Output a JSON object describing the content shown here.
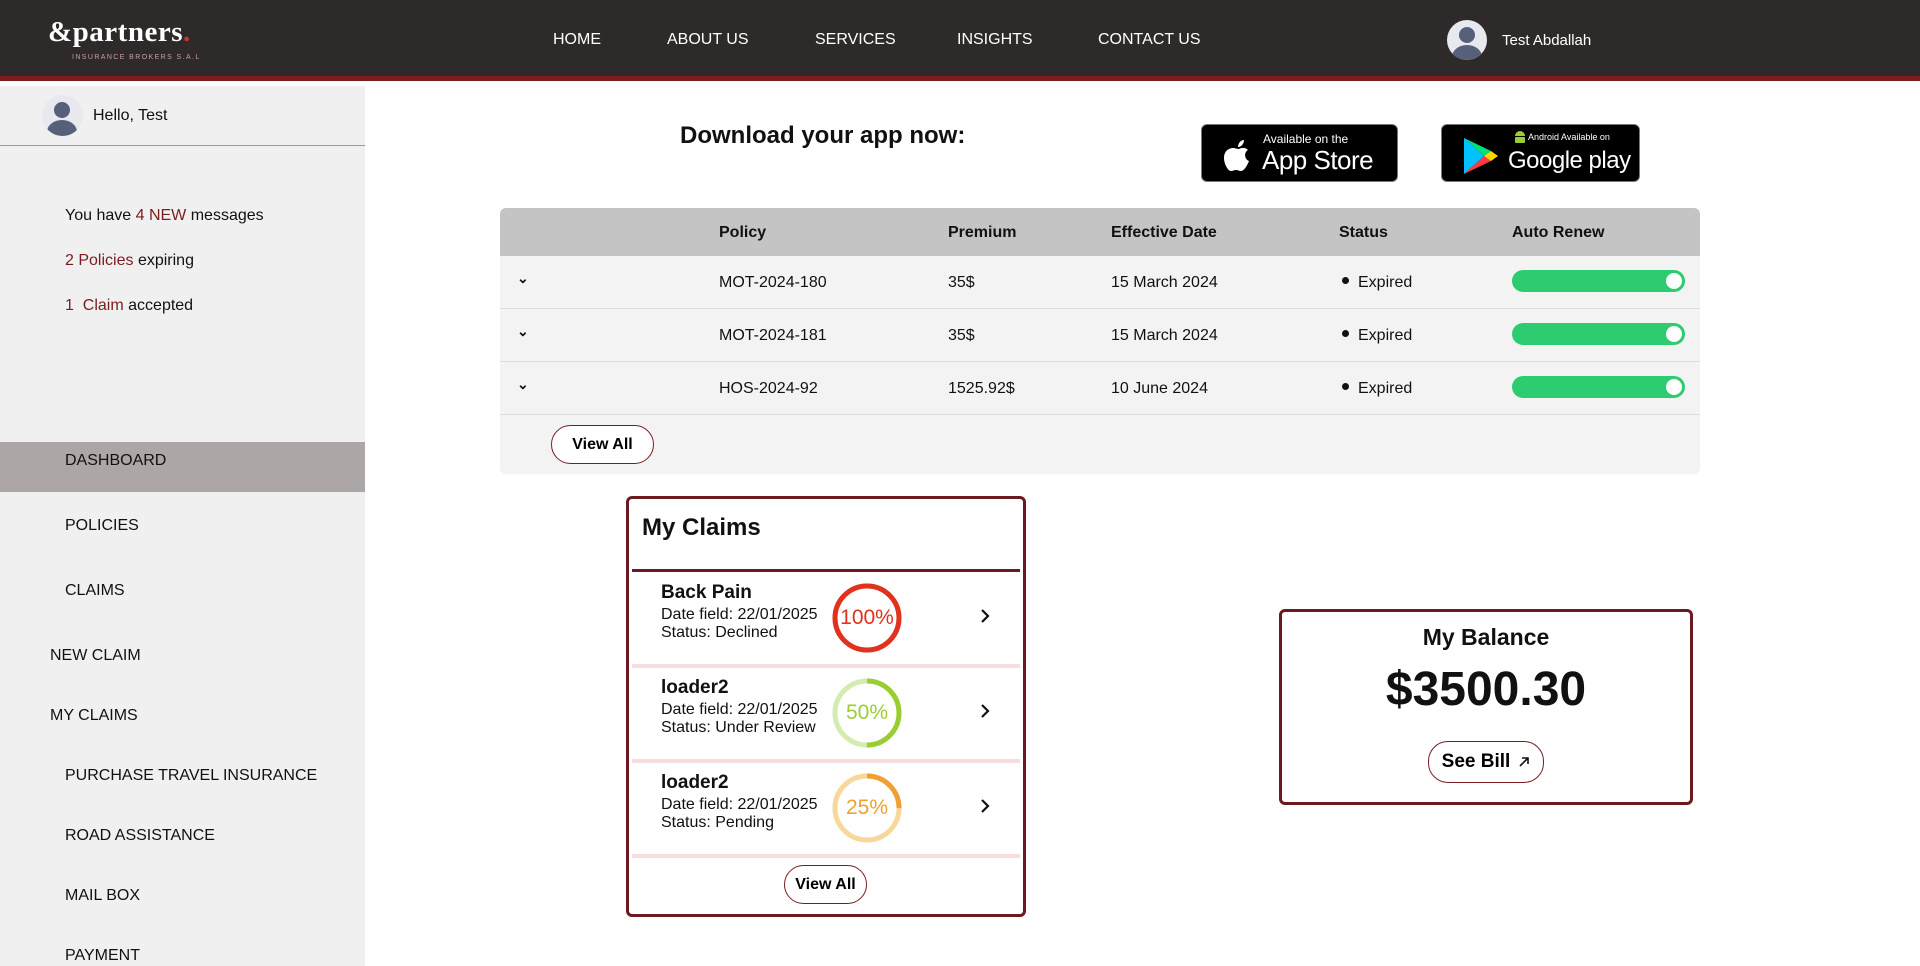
{
  "header": {
    "logo": {
      "symbol": "&",
      "word": "partners",
      "tagline": "INSURANCE BROKERS S.A.L"
    },
    "nav": [
      "HOME",
      "ABOUT US",
      "SERVICES",
      "INSIGHTS",
      "CONTACT US"
    ],
    "user_name": "Test Abdallah"
  },
  "sidebar": {
    "greeting": "Hello, Test",
    "notifications": {
      "messages_prefix": "You have",
      "messages_count": "4 NEW",
      "messages_suffix": "messages",
      "policies_count": "2 Policies",
      "policies_suffix": "expiring",
      "claims_count": "1  Claim",
      "claims_suffix": "accepted"
    },
    "menu": [
      "DASHBOARD",
      "POLICIES",
      "CLAIMS",
      "NEW CLAIM",
      "MY CLAIMS",
      "PURCHASE TRAVEL INSURANCE",
      "ROAD ASSISTANCE",
      "MAIL BOX",
      "PAYMENT"
    ],
    "active_item": "DASHBOARD"
  },
  "download": {
    "title": "Download your app now:",
    "app_store": {
      "small": "Available on the",
      "big": "App Store"
    },
    "google_play": {
      "small": "Android Available on",
      "big": "Google play"
    }
  },
  "policies": {
    "columns": [
      "Policy",
      "Premium",
      "Effective Date",
      "Status",
      "Auto Renew"
    ],
    "rows": [
      {
        "policy": "MOT-2024-180",
        "premium": "35$",
        "effective_date": "15 March 2024",
        "status": "Expired",
        "auto_renew": true
      },
      {
        "policy": "MOT-2024-181",
        "premium": "35$",
        "effective_date": "15 March 2024",
        "status": "Expired",
        "auto_renew": true
      },
      {
        "policy": "HOS-2024-92",
        "premium": "1525.92$",
        "effective_date": "10 June 2024",
        "status": "Expired",
        "auto_renew": true
      }
    ],
    "view_all": "View All"
  },
  "claims": {
    "title": "My Claims",
    "items": [
      {
        "name": "Back Pain",
        "date": "Date field: 22/01/2025",
        "status": "Status: Declined",
        "percent_label": "100%",
        "progress": 1.0,
        "color": "#e0321c",
        "track": "#f2b3a8"
      },
      {
        "name": "loader2",
        "date": "Date field: 22/01/2025",
        "status": "Status: Under Review",
        "percent_label": "50%",
        "progress": 0.5,
        "color": "#9acd32",
        "track": "#d4ecb0"
      },
      {
        "name": "loader2",
        "date": "Date field: 22/01/2025",
        "status": "Status: Pending",
        "percent_label": "25%",
        "progress": 0.25,
        "color": "#f0a030",
        "track": "#f7d89a"
      }
    ],
    "view_all": "View All"
  },
  "balance": {
    "title": "My Balance",
    "amount": "$3500.30",
    "button": "See Bill"
  },
  "colors": {
    "brand": "#7a1c20",
    "header_bg": "#2d2a29",
    "toggle_on": "#2ecc71"
  }
}
